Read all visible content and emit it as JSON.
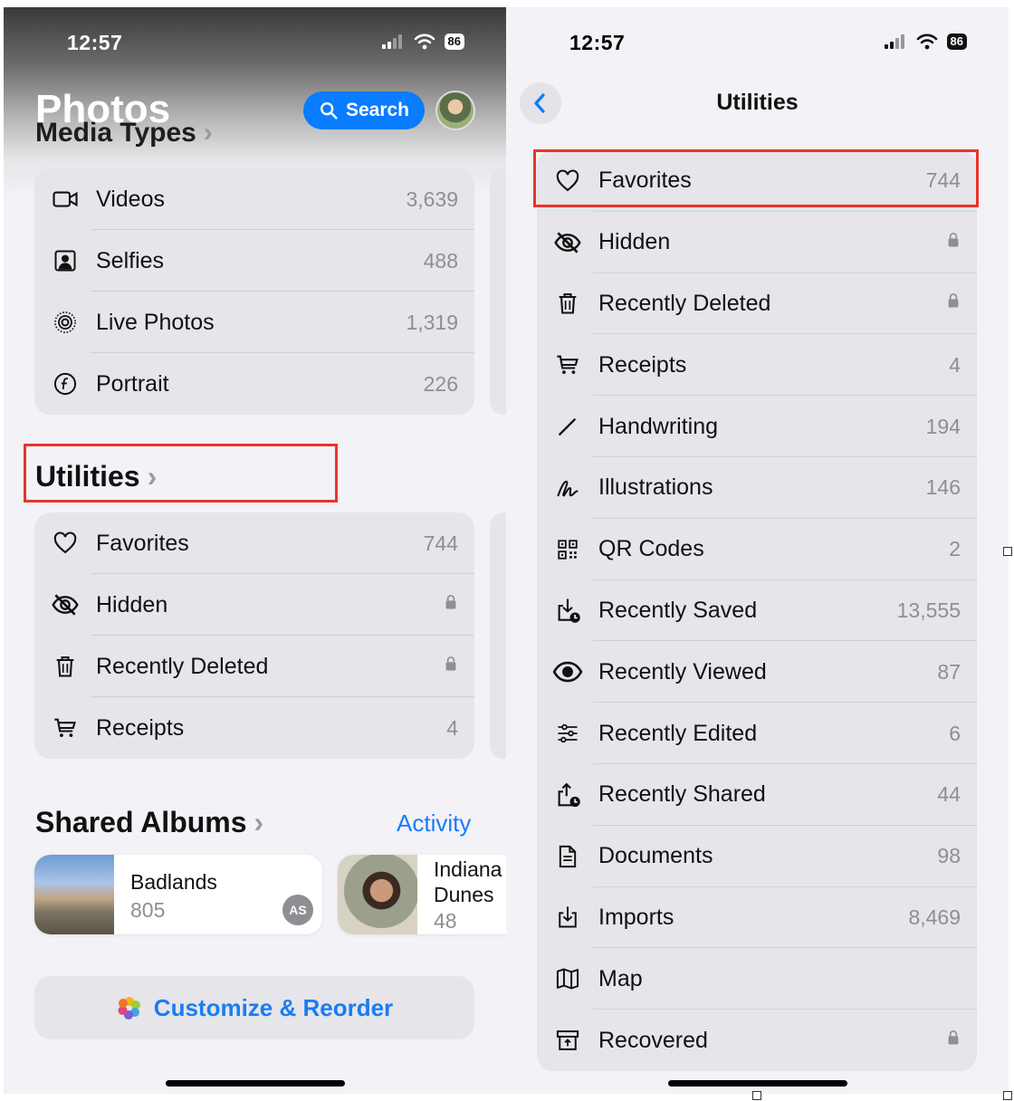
{
  "left": {
    "status": {
      "time": "12:57",
      "battery": "86"
    },
    "title": "Photos",
    "media_types_title": "Media Types",
    "search_label": "Search",
    "media_types": [
      {
        "label": "Videos",
        "count": "3,639",
        "icon": "video-icon"
      },
      {
        "label": "Selfies",
        "count": "488",
        "icon": "selfie-icon"
      },
      {
        "label": "Live Photos",
        "count": "1,319",
        "icon": "live-photos-icon"
      },
      {
        "label": "Portrait",
        "count": "226",
        "icon": "portrait-icon"
      }
    ],
    "utilities_title": "Utilities",
    "utilities": [
      {
        "label": "Favorites",
        "count": "744",
        "icon": "heart-icon"
      },
      {
        "label": "Hidden",
        "count": "",
        "icon": "eye-slash-icon",
        "locked": true
      },
      {
        "label": "Recently Deleted",
        "count": "",
        "icon": "trash-icon",
        "locked": true
      },
      {
        "label": "Receipts",
        "count": "4",
        "icon": "cart-icon"
      }
    ],
    "shared_albums_title": "Shared Albums",
    "activity_label": "Activity",
    "albums": [
      {
        "name": "Badlands",
        "count": "805",
        "badge": "AS"
      },
      {
        "name_line1": "Indiana",
        "name_line2": "Dunes",
        "count": "48"
      }
    ],
    "customize_label": "Customize & Reorder"
  },
  "right": {
    "status": {
      "time": "12:57",
      "battery": "86"
    },
    "title": "Utilities",
    "items": [
      {
        "label": "Favorites",
        "count": "744",
        "icon": "heart-icon"
      },
      {
        "label": "Hidden",
        "count": "",
        "icon": "eye-slash-icon",
        "locked": true
      },
      {
        "label": "Recently Deleted",
        "count": "",
        "icon": "trash-icon",
        "locked": true
      },
      {
        "label": "Receipts",
        "count": "4",
        "icon": "cart-icon"
      },
      {
        "label": "Handwriting",
        "count": "194",
        "icon": "pencil-icon"
      },
      {
        "label": "Illustrations",
        "count": "146",
        "icon": "scribble-icon"
      },
      {
        "label": "QR Codes",
        "count": "2",
        "icon": "qr-code-icon"
      },
      {
        "label": "Recently Saved",
        "count": "13,555",
        "icon": "recently-saved-icon"
      },
      {
        "label": "Recently Viewed",
        "count": "87",
        "icon": "eye-icon"
      },
      {
        "label": "Recently Edited",
        "count": "6",
        "icon": "sliders-icon"
      },
      {
        "label": "Recently Shared",
        "count": "44",
        "icon": "share-icon"
      },
      {
        "label": "Documents",
        "count": "98",
        "icon": "document-icon"
      },
      {
        "label": "Imports",
        "count": "8,469",
        "icon": "import-icon"
      },
      {
        "label": "Map",
        "count": "",
        "icon": "map-icon"
      },
      {
        "label": "Recovered",
        "count": "",
        "icon": "archive-icon",
        "locked": true
      }
    ]
  },
  "colors": {
    "accent": "#0a7cff",
    "highlight": "#e8342a",
    "card": "#e5e5ea",
    "background": "#f2f2f7"
  }
}
